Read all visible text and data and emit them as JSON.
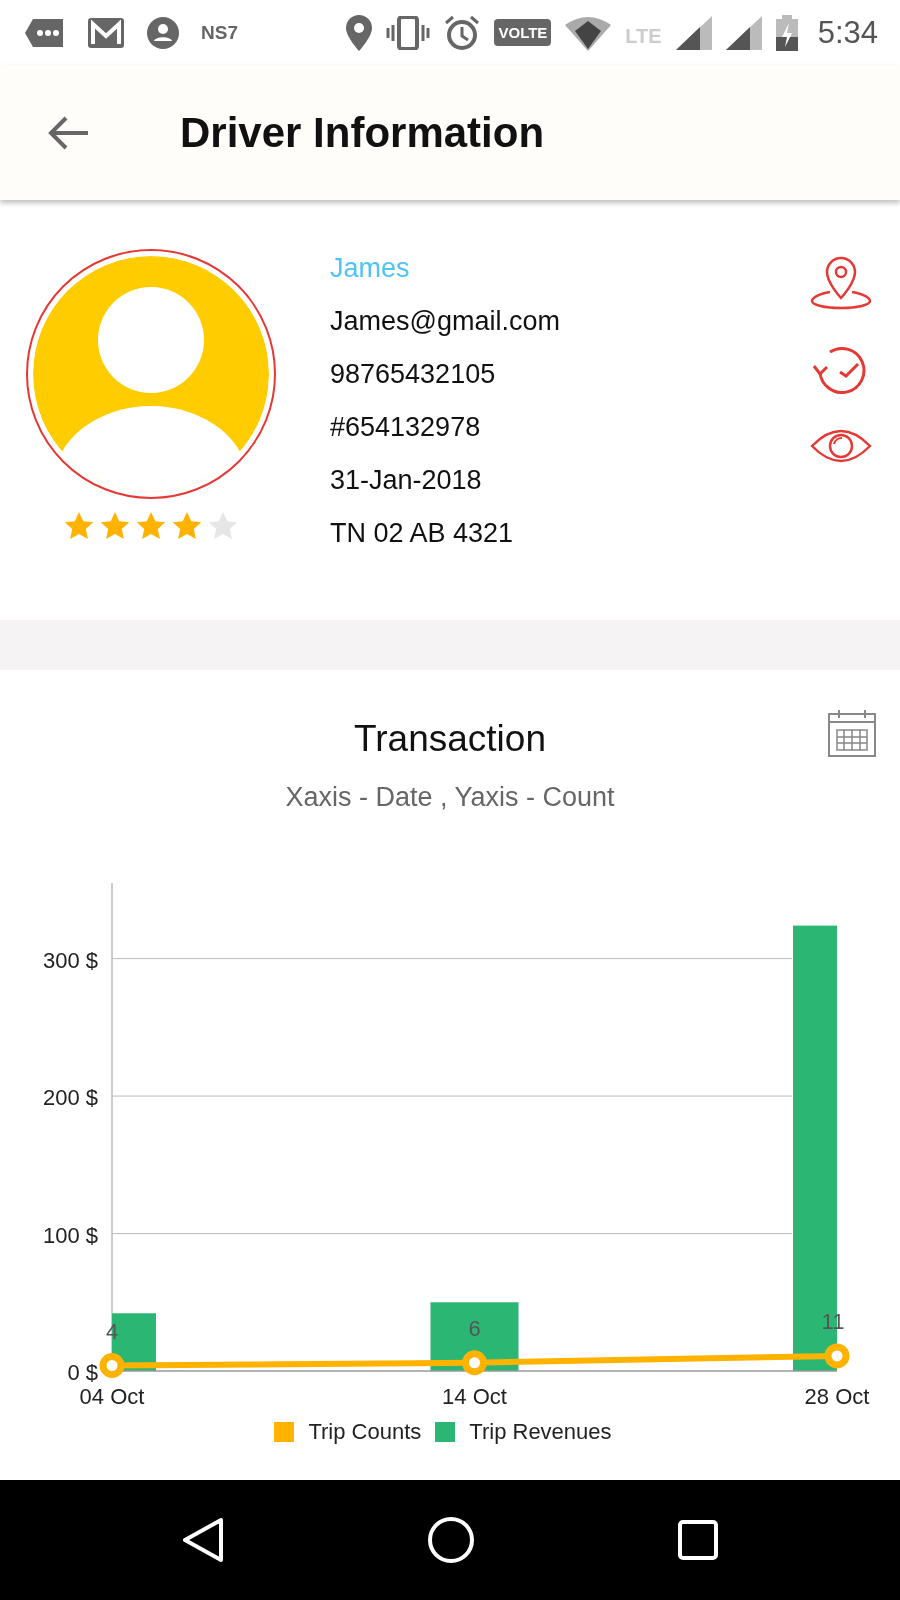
{
  "status_bar": {
    "carrier": "NS7",
    "volte": "VOLTE",
    "network": "LTE",
    "time": "5:34"
  },
  "app_bar": {
    "title": "Driver Information"
  },
  "driver": {
    "name": "James",
    "stars": 4,
    "details": [
      "James@gmail.com",
      "98765432105",
      "#654132978",
      "31-Jan-2018",
      "TN 02 AB 4321"
    ]
  },
  "transaction": {
    "title": "Transaction",
    "subtitle": "Xaxis - Date , Yaxis - Count",
    "chart_data": {
      "type": "bar",
      "categories": [
        "04 Oct",
        "14 Oct",
        "28 Oct"
      ],
      "ylim": [
        0,
        355
      ],
      "grid": true,
      "yticks": [
        {
          "value": 0,
          "label": "0 $"
        },
        {
          "value": 100,
          "label": "100 $"
        },
        {
          "value": 200,
          "label": "200 $"
        },
        {
          "value": 300,
          "label": "300 $"
        }
      ],
      "series": [
        {
          "name": "Trip Counts",
          "type": "line",
          "color": "#ffb300",
          "values": [
            4,
            6,
            11
          ],
          "data_labels": true
        },
        {
          "name": "Trip Revenues",
          "color": "#2bb673",
          "values": [
            42,
            50,
            324
          ],
          "data_labels": false
        }
      ]
    }
  }
}
